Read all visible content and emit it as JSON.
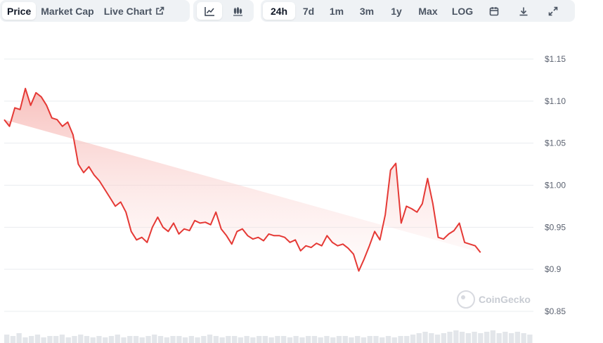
{
  "toolbar": {
    "views": [
      {
        "label": "Price",
        "active": true
      },
      {
        "label": "Market Cap",
        "active": false
      },
      {
        "label": "Live Chart",
        "active": false
      }
    ],
    "chart_types": [
      {
        "icon": "line-chart-icon",
        "active": true
      },
      {
        "icon": "candlestick-icon",
        "active": false
      }
    ],
    "ranges": [
      {
        "label": "24h",
        "active": true
      },
      {
        "label": "7d",
        "active": false
      },
      {
        "label": "1m",
        "active": false
      },
      {
        "label": "3m",
        "active": false
      },
      {
        "label": "1y",
        "active": false
      },
      {
        "label": "Max",
        "active": false
      },
      {
        "label": "LOG",
        "active": false
      }
    ],
    "tools": [
      "calendar-icon",
      "download-icon",
      "fullscreen-icon"
    ]
  },
  "watermark": "CoinGecko",
  "colors": {
    "line": "#e53935",
    "fill_top": "#f6b4b0",
    "grid": "#e9ecef",
    "toolbar_bg": "#eff2f5"
  },
  "chart_data": {
    "type": "area",
    "y_tick_labels": [
      "$1.15",
      "$1.10",
      "$1.05",
      "$1.00",
      "$0.95",
      "$0.9",
      "$0.85"
    ],
    "ylim": [
      0.85,
      1.15
    ],
    "grid": true,
    "x": [
      0,
      2,
      4,
      6,
      8,
      10,
      12,
      14,
      16,
      18,
      20,
      22,
      24,
      26,
      28,
      30,
      32,
      34,
      36,
      38,
      40,
      42,
      44,
      46,
      48,
      50,
      52,
      54,
      56,
      58,
      60,
      62,
      64,
      66,
      68,
      70,
      72,
      74,
      76,
      78,
      80,
      82,
      84,
      86,
      88,
      90,
      92,
      94,
      96,
      98,
      100,
      102,
      104,
      106,
      108,
      110,
      112,
      114,
      116,
      118,
      120,
      122,
      124,
      126,
      128,
      130,
      132,
      134,
      136,
      138,
      140,
      142,
      144,
      146,
      148,
      150,
      152,
      154,
      156,
      158,
      160,
      162,
      164,
      166,
      168,
      170,
      172,
      174,
      176,
      178,
      180,
      182,
      184,
      186,
      188,
      190,
      192,
      194,
      196,
      198,
      200
    ],
    "values": [
      1.078,
      1.07,
      1.092,
      1.09,
      1.115,
      1.095,
      1.11,
      1.105,
      1.095,
      1.08,
      1.078,
      1.07,
      1.075,
      1.06,
      1.025,
      1.015,
      1.022,
      1.012,
      1.005,
      0.995,
      0.985,
      0.975,
      0.98,
      0.968,
      0.945,
      0.935,
      0.938,
      0.932,
      0.95,
      0.962,
      0.95,
      0.945,
      0.955,
      0.942,
      0.948,
      0.946,
      0.958,
      0.955,
      0.956,
      0.953,
      0.968,
      0.948,
      0.94,
      0.93,
      0.945,
      0.948,
      0.94,
      0.936,
      0.938,
      0.934,
      0.942,
      0.94,
      0.94,
      0.938,
      0.932,
      0.935,
      0.922,
      0.928,
      0.926,
      0.931,
      0.928,
      0.94,
      0.932,
      0.928,
      0.93,
      0.925,
      0.918,
      0.898,
      0.912,
      0.928,
      0.945,
      0.935,
      0.965,
      1.018,
      1.026,
      0.955,
      0.975,
      0.972,
      0.968,
      0.978,
      1.008,
      0.978,
      0.938,
      0.936,
      0.942,
      0.946,
      0.955,
      0.932,
      0.93,
      0.928,
      0.92
    ],
    "volume_bars": [
      0.6,
      0.5,
      0.7,
      0.4,
      0.5,
      0.6,
      0.4,
      0.5,
      0.5,
      0.6,
      0.4,
      0.5,
      0.6,
      0.5,
      0.4,
      0.5,
      0.4,
      0.5,
      0.6,
      0.4,
      0.5,
      0.5,
      0.4,
      0.5,
      0.6,
      0.5,
      0.4,
      0.5,
      0.5,
      0.4,
      0.5,
      0.4,
      0.5,
      0.6,
      0.5,
      0.4,
      0.5,
      0.5,
      0.4,
      0.5,
      0.4,
      0.5,
      0.5,
      0.4,
      0.5,
      0.5,
      0.4,
      0.5,
      0.4,
      0.5,
      0.5,
      0.4,
      0.5,
      0.4,
      0.5,
      0.5,
      0.4,
      0.5,
      0.4,
      0.5,
      0.5,
      0.4,
      0.5,
      0.4,
      0.5,
      0.5,
      0.6,
      0.7,
      0.8,
      0.7,
      0.6,
      0.7,
      0.8,
      0.9,
      0.8,
      0.7,
      0.8,
      0.7,
      0.8,
      0.9,
      0.7,
      0.8,
      0.7,
      0.8,
      0.7,
      0.6
    ]
  }
}
